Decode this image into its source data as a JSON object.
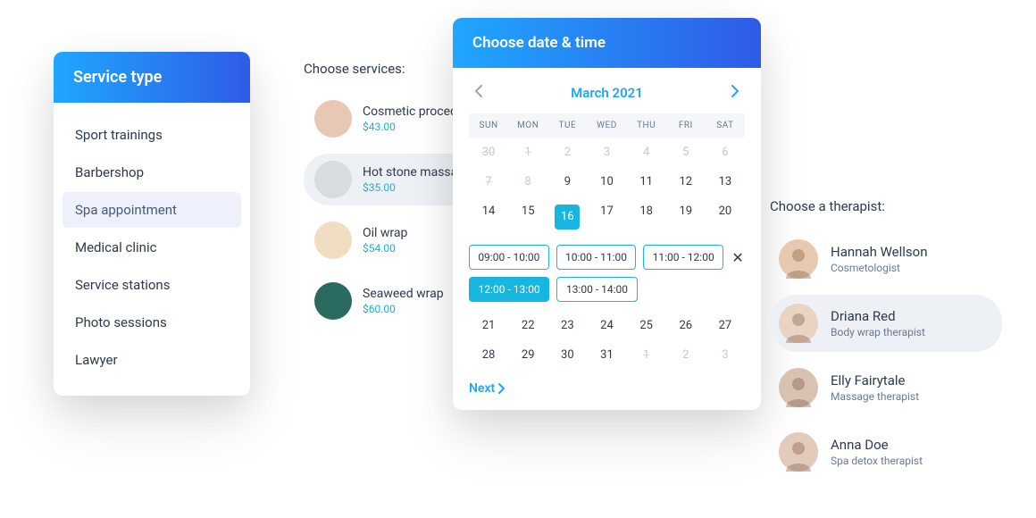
{
  "service_type": {
    "title": "Service type",
    "items": [
      {
        "label": "Sport trainings",
        "active": false
      },
      {
        "label": "Barbershop",
        "active": false
      },
      {
        "label": "Spa appointment",
        "active": true
      },
      {
        "label": "Medical clinic",
        "active": false
      },
      {
        "label": "Service stations",
        "active": false
      },
      {
        "label": "Photo sessions",
        "active": false
      },
      {
        "label": "Lawyer",
        "active": false
      }
    ]
  },
  "services": {
    "title": "Choose services:",
    "items": [
      {
        "name": "Cosmetic procedure",
        "price": "$43.00",
        "thumb_bg": "#e8c8b4",
        "active": false
      },
      {
        "name": "Hot stone massage",
        "price": "$35.00",
        "thumb_bg": "#d9dcde",
        "active": true
      },
      {
        "name": "Oil wrap",
        "price": "$54.00",
        "thumb_bg": "#f0ddc2",
        "active": false
      },
      {
        "name": "Seaweed wrap",
        "price": "$60.00",
        "thumb_bg": "#2a6a60",
        "active": false
      }
    ]
  },
  "calendar": {
    "title": "Choose date & time",
    "month_label": "March 2021",
    "dow": [
      "SUN",
      "MON",
      "TUE",
      "WED",
      "THU",
      "FRI",
      "SAT"
    ],
    "weeks": [
      [
        {
          "n": "30",
          "muted": true
        },
        {
          "n": "1",
          "muted": true
        },
        {
          "n": "2",
          "muted": true,
          "nostrike": true
        },
        {
          "n": "3",
          "muted": true,
          "nostrike": true
        },
        {
          "n": "4",
          "muted": true,
          "nostrike": true
        },
        {
          "n": "5",
          "muted": true,
          "nostrike": true
        },
        {
          "n": "6",
          "muted": true,
          "nostrike": true
        }
      ],
      [
        {
          "n": "7",
          "muted": true
        },
        {
          "n": "8",
          "muted": true,
          "nostrike": true
        },
        {
          "n": "9"
        },
        {
          "n": "10"
        },
        {
          "n": "11"
        },
        {
          "n": "12"
        },
        {
          "n": "13"
        }
      ],
      [
        {
          "n": "14"
        },
        {
          "n": "15"
        },
        {
          "n": "16",
          "selected": true
        },
        {
          "n": "17"
        },
        {
          "n": "18"
        },
        {
          "n": "19"
        },
        {
          "n": "20"
        }
      ],
      [
        {
          "n": "21"
        },
        {
          "n": "22"
        },
        {
          "n": "23"
        },
        {
          "n": "24"
        },
        {
          "n": "25"
        },
        {
          "n": "26"
        },
        {
          "n": "27"
        }
      ],
      [
        {
          "n": "28"
        },
        {
          "n": "29"
        },
        {
          "n": "30"
        },
        {
          "n": "31"
        },
        {
          "n": "1",
          "muted": true
        },
        {
          "n": "2",
          "muted": true,
          "nostrike": true
        },
        {
          "n": "3",
          "muted": true,
          "nostrike": true
        }
      ]
    ],
    "slots_row1": [
      {
        "label": "09:00 - 10:00",
        "selected": false
      },
      {
        "label": "10:00 - 11:00",
        "selected": false
      },
      {
        "label": "11:00 - 12:00",
        "selected": false
      }
    ],
    "slots_row2": [
      {
        "label": "12:00 - 13:00",
        "selected": true
      },
      {
        "label": "13:00 - 14:00",
        "selected": false
      }
    ],
    "close_glyph": "✕",
    "next_label": "Next"
  },
  "therapists": {
    "title": "Choose a therapist:",
    "items": [
      {
        "name": "Hannah Wellson",
        "role": "Cosmetologist",
        "thumb_bg": "#e6c9b0",
        "active": false
      },
      {
        "name": "Driana Red",
        "role": "Body wrap therapist",
        "thumb_bg": "#e9d4c4",
        "active": true
      },
      {
        "name": "Elly Fairytale",
        "role": "Massage therapist",
        "thumb_bg": "#d8c2b2",
        "active": false
      },
      {
        "name": "Anna Doe",
        "role": "Spa detox therapist",
        "thumb_bg": "#e3cbbc",
        "active": false
      }
    ]
  }
}
